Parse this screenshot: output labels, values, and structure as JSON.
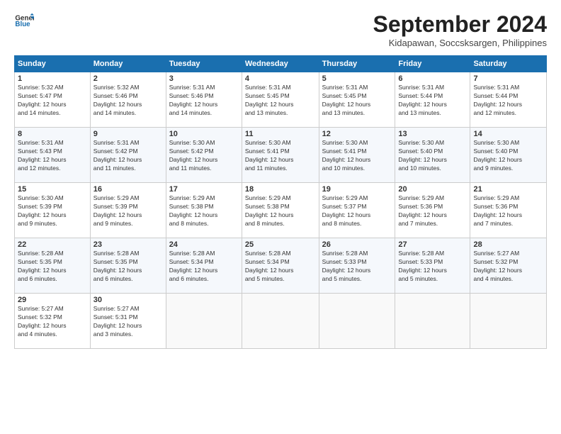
{
  "header": {
    "logo_line1": "General",
    "logo_line2": "Blue",
    "month_title": "September 2024",
    "location": "Kidapawan, Soccsksargen, Philippines"
  },
  "days_of_week": [
    "Sunday",
    "Monday",
    "Tuesday",
    "Wednesday",
    "Thursday",
    "Friday",
    "Saturday"
  ],
  "weeks": [
    [
      {
        "num": "1",
        "rise": "5:32 AM",
        "set": "5:47 PM",
        "daylight": "12 hours and 14 minutes."
      },
      {
        "num": "2",
        "rise": "5:32 AM",
        "set": "5:46 PM",
        "daylight": "12 hours and 14 minutes."
      },
      {
        "num": "3",
        "rise": "5:31 AM",
        "set": "5:46 PM",
        "daylight": "12 hours and 14 minutes."
      },
      {
        "num": "4",
        "rise": "5:31 AM",
        "set": "5:45 PM",
        "daylight": "12 hours and 13 minutes."
      },
      {
        "num": "5",
        "rise": "5:31 AM",
        "set": "5:45 PM",
        "daylight": "12 hours and 13 minutes."
      },
      {
        "num": "6",
        "rise": "5:31 AM",
        "set": "5:44 PM",
        "daylight": "12 hours and 13 minutes."
      },
      {
        "num": "7",
        "rise": "5:31 AM",
        "set": "5:44 PM",
        "daylight": "12 hours and 12 minutes."
      }
    ],
    [
      {
        "num": "8",
        "rise": "5:31 AM",
        "set": "5:43 PM",
        "daylight": "12 hours and 12 minutes."
      },
      {
        "num": "9",
        "rise": "5:31 AM",
        "set": "5:42 PM",
        "daylight": "12 hours and 11 minutes."
      },
      {
        "num": "10",
        "rise": "5:30 AM",
        "set": "5:42 PM",
        "daylight": "12 hours and 11 minutes."
      },
      {
        "num": "11",
        "rise": "5:30 AM",
        "set": "5:41 PM",
        "daylight": "12 hours and 11 minutes."
      },
      {
        "num": "12",
        "rise": "5:30 AM",
        "set": "5:41 PM",
        "daylight": "12 hours and 10 minutes."
      },
      {
        "num": "13",
        "rise": "5:30 AM",
        "set": "5:40 PM",
        "daylight": "12 hours and 10 minutes."
      },
      {
        "num": "14",
        "rise": "5:30 AM",
        "set": "5:40 PM",
        "daylight": "12 hours and 9 minutes."
      }
    ],
    [
      {
        "num": "15",
        "rise": "5:30 AM",
        "set": "5:39 PM",
        "daylight": "12 hours and 9 minutes."
      },
      {
        "num": "16",
        "rise": "5:29 AM",
        "set": "5:39 PM",
        "daylight": "12 hours and 9 minutes."
      },
      {
        "num": "17",
        "rise": "5:29 AM",
        "set": "5:38 PM",
        "daylight": "12 hours and 8 minutes."
      },
      {
        "num": "18",
        "rise": "5:29 AM",
        "set": "5:38 PM",
        "daylight": "12 hours and 8 minutes."
      },
      {
        "num": "19",
        "rise": "5:29 AM",
        "set": "5:37 PM",
        "daylight": "12 hours and 8 minutes."
      },
      {
        "num": "20",
        "rise": "5:29 AM",
        "set": "5:36 PM",
        "daylight": "12 hours and 7 minutes."
      },
      {
        "num": "21",
        "rise": "5:29 AM",
        "set": "5:36 PM",
        "daylight": "12 hours and 7 minutes."
      }
    ],
    [
      {
        "num": "22",
        "rise": "5:28 AM",
        "set": "5:35 PM",
        "daylight": "12 hours and 6 minutes."
      },
      {
        "num": "23",
        "rise": "5:28 AM",
        "set": "5:35 PM",
        "daylight": "12 hours and 6 minutes."
      },
      {
        "num": "24",
        "rise": "5:28 AM",
        "set": "5:34 PM",
        "daylight": "12 hours and 6 minutes."
      },
      {
        "num": "25",
        "rise": "5:28 AM",
        "set": "5:34 PM",
        "daylight": "12 hours and 5 minutes."
      },
      {
        "num": "26",
        "rise": "5:28 AM",
        "set": "5:33 PM",
        "daylight": "12 hours and 5 minutes."
      },
      {
        "num": "27",
        "rise": "5:28 AM",
        "set": "5:33 PM",
        "daylight": "12 hours and 5 minutes."
      },
      {
        "num": "28",
        "rise": "5:27 AM",
        "set": "5:32 PM",
        "daylight": "12 hours and 4 minutes."
      }
    ],
    [
      {
        "num": "29",
        "rise": "5:27 AM",
        "set": "5:32 PM",
        "daylight": "12 hours and 4 minutes."
      },
      {
        "num": "30",
        "rise": "5:27 AM",
        "set": "5:31 PM",
        "daylight": "12 hours and 3 minutes."
      },
      null,
      null,
      null,
      null,
      null
    ]
  ],
  "labels": {
    "sunrise": "Sunrise:",
    "sunset": "Sunset:",
    "daylight": "Daylight: 12 hours"
  }
}
